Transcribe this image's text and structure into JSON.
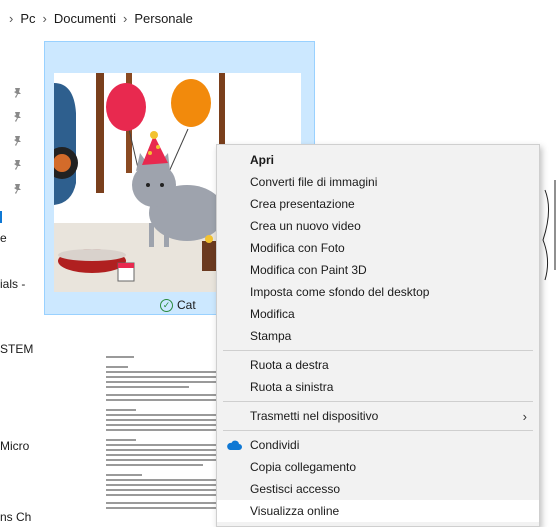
{
  "breadcrumb": {
    "items": [
      "Pc",
      "Documenti",
      "Personale"
    ]
  },
  "nav": {
    "partial_items": [
      "e",
      "ials -",
      "STEM",
      "Micro",
      "ns Ch"
    ]
  },
  "files": {
    "cat": {
      "name": "Cat",
      "status": "synced"
    },
    "document": {
      "name": ""
    }
  },
  "context_menu": {
    "items": [
      {
        "label": "Apri",
        "bold": true
      },
      {
        "label": "Converti file di immagini"
      },
      {
        "label": "Crea presentazione"
      },
      {
        "label": "Crea un nuovo video"
      },
      {
        "label": "Modifica con Foto"
      },
      {
        "label": "Modifica con Paint 3D"
      },
      {
        "label": "Imposta come sfondo del desktop"
      },
      {
        "label": "Modifica"
      },
      {
        "label": "Stampa"
      },
      {
        "label": "Ruota a destra"
      },
      {
        "label": "Ruota a sinistra"
      },
      {
        "label": "Trasmetti nel dispositivo",
        "submenu": true
      },
      {
        "label": "Condividi",
        "icon": "cloud-icon"
      },
      {
        "label": "Copia collegamento"
      },
      {
        "label": "Gestisci accesso"
      },
      {
        "label": "Visualizza online",
        "hover": true
      }
    ]
  },
  "colors": {
    "selection_bg": "#cce8ff",
    "selection_border": "#99d1ff",
    "menu_bg": "#f2f2f2",
    "onedrive_blue": "#0f78d4",
    "sync_green": "#2b8a3e"
  }
}
